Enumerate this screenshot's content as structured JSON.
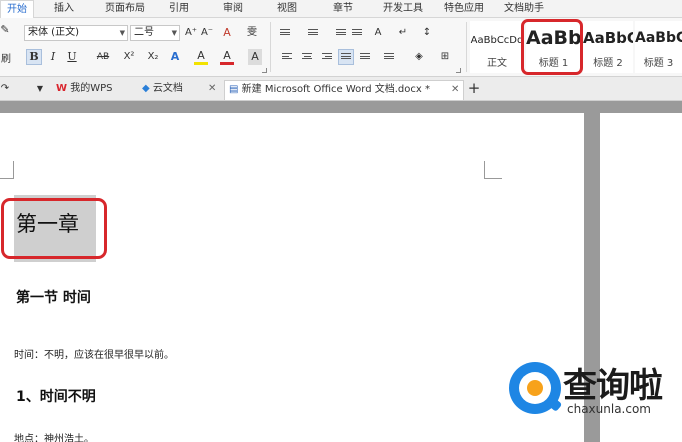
{
  "menu": {
    "tabs": [
      "开始",
      "插入",
      "页面布局",
      "引用",
      "审阅",
      "视图",
      "章节",
      "开发工具",
      "特色应用",
      "文档助手"
    ],
    "active_index": 0
  },
  "ribbon": {
    "font_name": "宋体 (正文)",
    "font_size": "二号",
    "bold": "B",
    "italic": "I",
    "underline": "U",
    "strike": "AB",
    "superscript": "X²",
    "subscript": "X₂",
    "grow_font": "A⁺",
    "shrink_font": "A⁻",
    "clear_format": "A",
    "phonetic": "雯",
    "text_effect": "A",
    "highlight": "A",
    "font_color": "A",
    "char_shade": "A",
    "left_label": "刷"
  },
  "styles": [
    {
      "sample": "AaBbCcDd",
      "name": "正文",
      "selected": false
    },
    {
      "sample": "AaBb",
      "name": "标题 1",
      "selected": true
    },
    {
      "sample": "AaBbC",
      "name": "标题 2",
      "selected": false
    },
    {
      "sample": "AaBbC",
      "name": "标题 3",
      "selected": false
    }
  ],
  "doc_tabs": [
    {
      "label": "我的WPS",
      "icon": "wps-logo-icon",
      "color": "#d9262e"
    },
    {
      "label": "云文档",
      "icon": "cloud-box-icon",
      "color": "#2a7fd8"
    },
    {
      "label": "新建 Microsoft Office Word 文档.docx *",
      "icon": "word-doc-icon",
      "color": "#2a62b8",
      "active": true
    }
  ],
  "document": {
    "chapter_title": "第一章",
    "section_title": "第一节  时间",
    "paragraph_1": "时间：不明，应该在很早很早以前。",
    "heading_1": "1、时间不明",
    "paragraph_2": "地点：神州浩土。"
  },
  "watermark": {
    "text_cn": "查询啦",
    "text_en": "chaxunla.com"
  },
  "colors": {
    "accent": "#2a6ecf",
    "highlight_outline": "#d7272b",
    "logo_blue": "#1e86e4",
    "logo_orange": "#f7a21b"
  }
}
